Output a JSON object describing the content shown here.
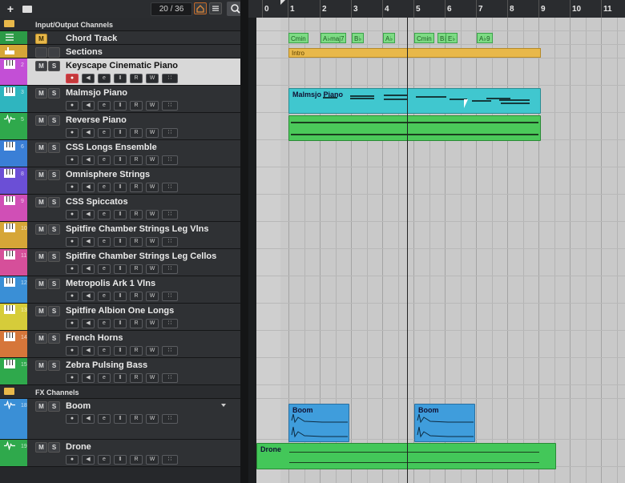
{
  "toolbar": {
    "add_label": "+",
    "add_folder_label": "+",
    "counter": "20 / 36"
  },
  "colors": {
    "selected_track": "#d8d8d8",
    "chord_event": "#7ddb84",
    "section_intro": "#e8b84a",
    "piano_event": "#40c7cf",
    "green_event": "#4bc95a",
    "boom_event": "#3f9ddc"
  },
  "tracks": [
    {
      "name": "Input/Output Channels",
      "kind": "folder",
      "color": "#2b2d30",
      "icon": "folder-icon"
    },
    {
      "name": "Chord Track",
      "kind": "chord",
      "color": "#2c9a46",
      "icon": "chord-icon"
    },
    {
      "name": "Sections",
      "kind": "marker",
      "color": "#d6a637",
      "icon": "sections-icon"
    },
    {
      "name": "Keyscape Cinematic Piano",
      "num": "2",
      "kind": "instrument",
      "color": "#c34fd6",
      "icon": "midi-icon",
      "selected": true
    },
    {
      "name": "Malmsjo Piano",
      "num": "3",
      "kind": "instrument",
      "color": "#2fb5bf",
      "icon": "midi-icon"
    },
    {
      "name": "Reverse Piano",
      "num": "5",
      "kind": "audio",
      "color": "#2fa94c",
      "icon": "audio-icon"
    },
    {
      "name": "CSS Longs Ensemble",
      "num": "6",
      "kind": "instrument",
      "color": "#3a7fd6",
      "icon": "midi-icon"
    },
    {
      "name": "Omnisphere Strings",
      "num": "8",
      "kind": "instrument",
      "color": "#6b4fd6",
      "icon": "midi-icon"
    },
    {
      "name": "CSS Spiccatos",
      "num": "9",
      "kind": "instrument",
      "color": "#d04fb6",
      "icon": "midi-icon"
    },
    {
      "name": "Spitfire Chamber Strings Leg Vlns",
      "num": "10",
      "kind": "instrument",
      "color": "#d6a637",
      "icon": "midi-icon"
    },
    {
      "name": "Spitfire Chamber Strings Leg Cellos",
      "num": "11",
      "kind": "instrument",
      "color": "#d64f9a",
      "icon": "midi-icon"
    },
    {
      "name": "Metropolis Ark 1 Vlns",
      "num": "12",
      "kind": "instrument",
      "color": "#3a8fd6",
      "icon": "midi-icon"
    },
    {
      "name": "Spitfire Albion One Longs",
      "num": "13",
      "kind": "instrument",
      "color": "#d6cc3a",
      "icon": "midi-icon"
    },
    {
      "name": "French Horns",
      "num": "14",
      "kind": "instrument",
      "color": "#d6763a",
      "icon": "midi-icon"
    },
    {
      "name": "Zebra Pulsing Bass",
      "num": "15",
      "kind": "instrument",
      "color": "#2fa94c",
      "icon": "midi-icon"
    },
    {
      "name": "FX Channels",
      "kind": "folder",
      "color": "#2b2d30",
      "icon": "folder-icon"
    },
    {
      "name": "Boom",
      "num": "18",
      "kind": "audio",
      "color": "#3a8fd6",
      "icon": "audio-icon"
    },
    {
      "name": "Drone",
      "num": "19",
      "kind": "audio",
      "color": "#2fa94c",
      "icon": "audio-icon"
    }
  ],
  "ruler": {
    "bars": [
      "0",
      "1",
      "2",
      "3",
      "4",
      "5",
      "6",
      "7",
      "8",
      "9",
      "10",
      "11"
    ]
  },
  "chords": [
    "Cmin",
    "A♭maj7",
    "B♭",
    "A♭",
    "Cmin",
    "B♭",
    "E♭",
    "A♭9"
  ],
  "section_label": "Intro",
  "events": {
    "piano": "Malmsjo Piano",
    "boom1": "Boom",
    "boom2": "Boom",
    "drone": "Drone"
  }
}
